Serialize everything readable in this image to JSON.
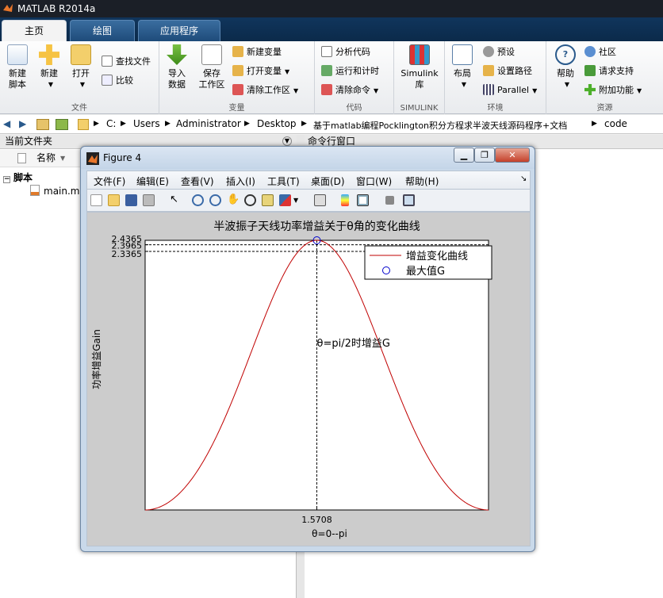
{
  "app": {
    "title": "MATLAB R2014a"
  },
  "tabs": [
    {
      "label": "主页",
      "active": true
    },
    {
      "label": "绘图",
      "active": false
    },
    {
      "label": "应用程序",
      "active": false
    }
  ],
  "ribbon": {
    "file_group": {
      "name": "文件",
      "new_script": "新建\n脚本",
      "new": "新建",
      "open": "打开",
      "find_files": "查找文件",
      "compare": "比较"
    },
    "var_group": {
      "name": "变量",
      "import": "导入\n数据",
      "save_ws": "保存\n工作区",
      "new_var": "新建变量",
      "open_var": "打开变量",
      "clear_ws": "清除工作区"
    },
    "code_group": {
      "name": "代码",
      "analyze": "分析代码",
      "run_time": "运行和计时",
      "clear_cmd": "清除命令"
    },
    "simulink_group": {
      "name": "SIMULINK",
      "simulink": "Simulink\n库"
    },
    "env_group": {
      "name": "环境",
      "layout": "布局",
      "prefs": "预设",
      "set_path": "设置路径",
      "parallel": "Parallel"
    },
    "res_group": {
      "name": "资源",
      "help": "帮助",
      "community": "社区",
      "support": "请求支持",
      "addons": "附加功能"
    }
  },
  "address": {
    "crumbs": [
      "C:",
      "Users",
      "Administrator",
      "Desktop",
      "基于matlab编程Pocklington积分方程求半波天线源码程序+文档",
      "code"
    ]
  },
  "left_panel": {
    "title": "当前文件夹",
    "column": "名称",
    "folder": "脚本",
    "file": "main.m"
  },
  "right_panel": {
    "title": "命令行窗口"
  },
  "figure": {
    "title": "Figure 4",
    "menu": [
      "文件(F)",
      "编辑(E)",
      "查看(V)",
      "插入(I)",
      "工具(T)",
      "桌面(D)",
      "窗口(W)",
      "帮助(H)"
    ],
    "buttons": {
      "min": "▁",
      "max": "❐",
      "close": "✕"
    }
  },
  "chart_data": {
    "type": "line",
    "title": "半波振子天线功率增益关于θ角的变化曲线",
    "xlabel": "θ=0--pi",
    "ylabel": "功率增益Gain",
    "xlim": [
      0,
      3.1416
    ],
    "ylim": [
      0,
      2.4365
    ],
    "xticks": [
      "1.5708"
    ],
    "yticks": [
      "2.4365",
      "2.3965",
      "2.3365"
    ],
    "ytick_values": [
      2.4365,
      2.3965,
      2.3365
    ],
    "series": [
      {
        "name": "增益变化曲线",
        "color": "#c00000",
        "function": "gain(theta)"
      }
    ],
    "max_point": {
      "name": "最大值G",
      "x": 1.5708,
      "y": 2.4365
    },
    "annotation": "θ=pi/2时增益G",
    "legend_position": "top-right",
    "grid": false
  }
}
